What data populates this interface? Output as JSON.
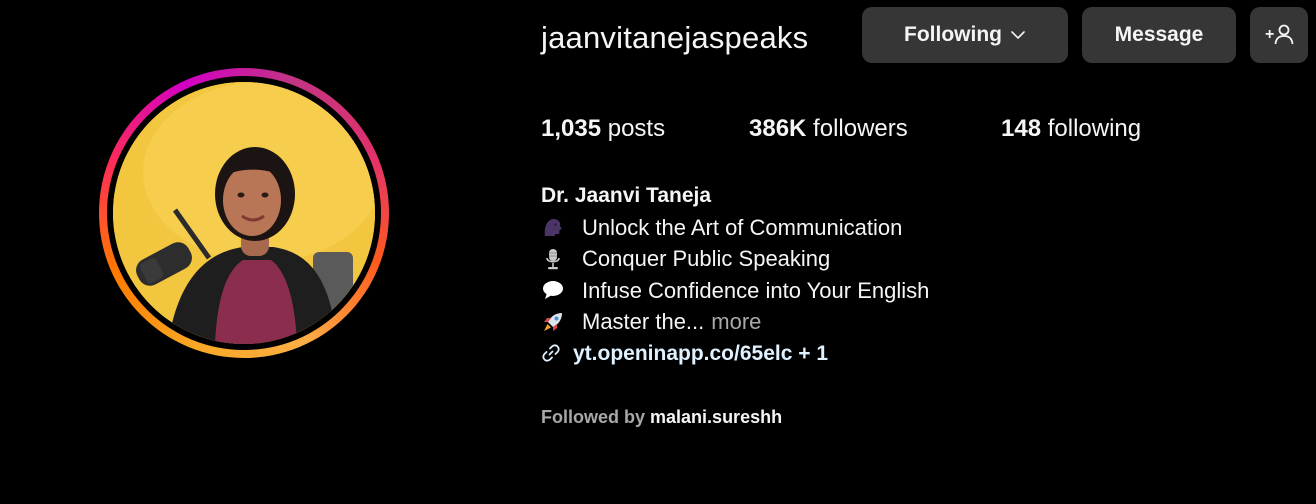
{
  "profile": {
    "username": "jaanvitanejaspeaks",
    "actions": {
      "following_label": "Following",
      "message_label": "Message",
      "add_user_glyph": "+"
    },
    "stats": {
      "posts_count": "1,035",
      "posts_label": "posts",
      "followers_count": "386K",
      "followers_label": "followers",
      "following_count": "148",
      "following_label": "following"
    },
    "bio": {
      "name": "Dr. Jaanvi Taneja",
      "lines": [
        {
          "icon": "speaking-head-icon",
          "text": "Unlock the Art of Communication"
        },
        {
          "icon": "microphone-icon",
          "text": "Conquer Public Speaking"
        },
        {
          "icon": "speech-bubble-icon",
          "text": "Infuse Confidence into Your English"
        },
        {
          "icon": "rocket-icon",
          "text": "Master the..."
        }
      ],
      "more_label": "more",
      "link_text": "yt.openinapp.co/65elc + 1"
    },
    "followed_by": {
      "prefix": "Followed by",
      "user": "malani.sureshh"
    }
  },
  "colors": {
    "background": "#000000",
    "button_bg": "#363636",
    "muted_text": "#a8a8a8",
    "link_text": "#e0f1ff",
    "avatar_bg": "#f4c842"
  }
}
